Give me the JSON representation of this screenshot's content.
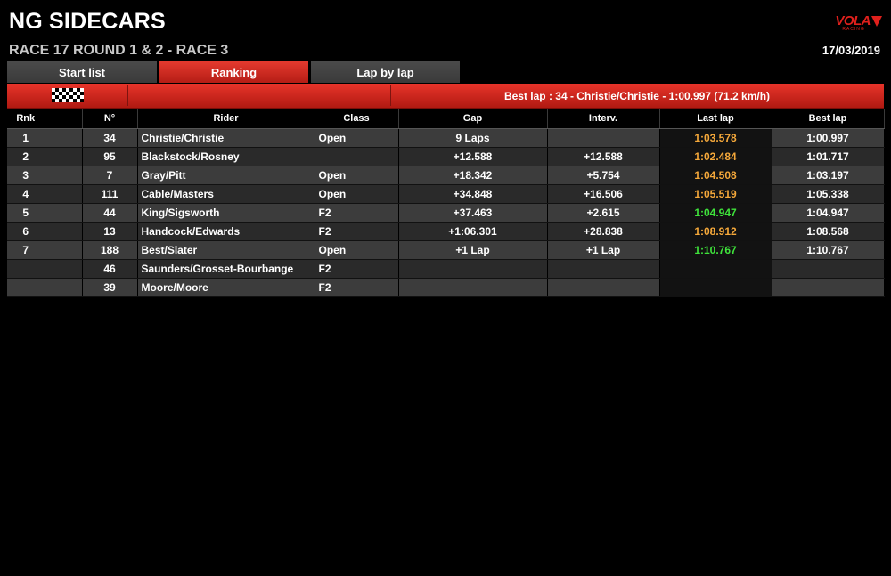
{
  "header": {
    "title": "NG SIDECARS",
    "subtitle": "RACE 17 ROUND 1 & 2 - RACE 3",
    "date": "17/03/2019",
    "logo_text": "VOLA",
    "logo_sub": "RACING"
  },
  "tabs": [
    {
      "label": "Start list",
      "active": false
    },
    {
      "label": "Ranking",
      "active": true
    },
    {
      "label": "Lap by lap",
      "active": false
    }
  ],
  "banner": {
    "best_lap": "Best lap : 34 - Christie/Christie - 1:00.997 (71.2 km/h)"
  },
  "table": {
    "headers": [
      "Rnk",
      "",
      "N°",
      "Rider",
      "Class",
      "Gap",
      "Interv.",
      "Last lap",
      "Best lap"
    ],
    "rows": [
      {
        "rnk": "1",
        "num": "34",
        "rider": "Christie/Christie",
        "class": "Open",
        "gap": "9 Laps",
        "interv": "",
        "last": "1:03.578",
        "last_color": "orange",
        "best": "1:00.997"
      },
      {
        "rnk": "2",
        "num": "95",
        "rider": "Blackstock/Rosney",
        "class": "",
        "gap": "+12.588",
        "interv": "+12.588",
        "last": "1:02.484",
        "last_color": "orange",
        "best": "1:01.717"
      },
      {
        "rnk": "3",
        "num": "7",
        "rider": "Gray/Pitt",
        "class": "Open",
        "gap": "+18.342",
        "interv": "+5.754",
        "last": "1:04.508",
        "last_color": "orange",
        "best": "1:03.197"
      },
      {
        "rnk": "4",
        "num": "111",
        "rider": "Cable/Masters",
        "class": "Open",
        "gap": "+34.848",
        "interv": "+16.506",
        "last": "1:05.519",
        "last_color": "orange",
        "best": "1:05.338"
      },
      {
        "rnk": "5",
        "num": "44",
        "rider": "King/Sigsworth",
        "class": "F2",
        "gap": "+37.463",
        "interv": "+2.615",
        "last": "1:04.947",
        "last_color": "green",
        "best": "1:04.947"
      },
      {
        "rnk": "6",
        "num": "13",
        "rider": "Handcock/Edwards",
        "class": "F2",
        "gap": "+1:06.301",
        "interv": "+28.838",
        "last": "1:08.912",
        "last_color": "orange",
        "best": "1:08.568"
      },
      {
        "rnk": "7",
        "num": "188",
        "rider": "Best/Slater",
        "class": "Open",
        "gap": "+1 Lap",
        "interv": "+1 Lap",
        "last": "1:10.767",
        "last_color": "green",
        "best": "1:10.767"
      },
      {
        "rnk": "",
        "num": "46",
        "rider": "Saunders/Grosset-Bourbange",
        "class": "F2",
        "gap": "",
        "interv": "",
        "last": "",
        "last_color": "",
        "best": ""
      },
      {
        "rnk": "",
        "num": "39",
        "rider": "Moore/Moore",
        "class": "F2",
        "gap": "",
        "interv": "",
        "last": "",
        "last_color": "",
        "best": ""
      }
    ]
  },
  "colors": {
    "accent_red": "#d62a20",
    "last_lap_orange": "#f5a83a",
    "last_lap_green": "#3fe33b"
  }
}
